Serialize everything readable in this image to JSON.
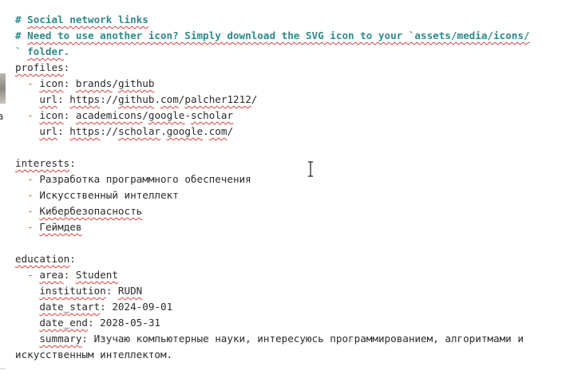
{
  "editor": {
    "lines": [
      {
        "type": "comment",
        "parts": [
          {
            "t": "# "
          },
          {
            "t": "Social network links",
            "sp": true
          }
        ]
      },
      {
        "type": "comment",
        "parts": [
          {
            "t": "# "
          },
          {
            "t": "Need to use another icon? Simply download the SVG icon to your `assets/media/icons/",
            "sp": true
          }
        ]
      },
      {
        "type": "comment",
        "parts": [
          {
            "t": "` "
          },
          {
            "t": "folder",
            "sp": true
          },
          {
            "t": "."
          }
        ]
      },
      {
        "type": "code",
        "parts": [
          {
            "t": "profiles",
            "sp": true
          },
          {
            "t": ":"
          }
        ]
      },
      {
        "type": "code",
        "parts": [
          {
            "t": "  "
          },
          {
            "t": "-",
            "dash": true
          },
          {
            "t": " "
          },
          {
            "t": "icon",
            "sp": true
          },
          {
            "t": ": "
          },
          {
            "t": "brands",
            "sp": true
          },
          {
            "t": "/"
          },
          {
            "t": "github",
            "sp": true
          }
        ]
      },
      {
        "type": "code",
        "parts": [
          {
            "t": "    "
          },
          {
            "t": "url",
            "sp": true
          },
          {
            "t": ": "
          },
          {
            "t": "https",
            "sp": true
          },
          {
            "t": "://"
          },
          {
            "t": "github",
            "sp": true
          },
          {
            "t": "."
          },
          {
            "t": "com",
            "sp": true
          },
          {
            "t": "/"
          },
          {
            "t": "palcher1212",
            "sp": true
          },
          {
            "t": "/"
          }
        ]
      },
      {
        "type": "code",
        "parts": [
          {
            "t": "  "
          },
          {
            "t": "-",
            "dash": true
          },
          {
            "t": " "
          },
          {
            "t": "icon",
            "sp": true
          },
          {
            "t": ": "
          },
          {
            "t": "academicons",
            "sp": true
          },
          {
            "t": "/"
          },
          {
            "t": "google",
            "sp": true
          },
          {
            "t": "-"
          },
          {
            "t": "scholar",
            "sp": true
          }
        ]
      },
      {
        "type": "code",
        "parts": [
          {
            "t": "    "
          },
          {
            "t": "url",
            "sp": true
          },
          {
            "t": ": "
          },
          {
            "t": "https",
            "sp": true
          },
          {
            "t": "://"
          },
          {
            "t": "scholar",
            "sp": true
          },
          {
            "t": "."
          },
          {
            "t": "google",
            "sp": true
          },
          {
            "t": "."
          },
          {
            "t": "com",
            "sp": true
          },
          {
            "t": "/"
          }
        ]
      },
      {
        "type": "blank",
        "parts": []
      },
      {
        "type": "code",
        "parts": [
          {
            "t": "interests",
            "sp": true
          },
          {
            "t": ":"
          }
        ]
      },
      {
        "type": "code",
        "parts": [
          {
            "t": "  "
          },
          {
            "t": "-",
            "dash": true
          },
          {
            "t": " Разработка программного обеспечения"
          }
        ]
      },
      {
        "type": "code",
        "parts": [
          {
            "t": "  "
          },
          {
            "t": "-",
            "dash": true
          },
          {
            "t": " Искусственный интеллект"
          }
        ]
      },
      {
        "type": "code",
        "parts": [
          {
            "t": "  "
          },
          {
            "t": "-",
            "dash": true
          },
          {
            "t": " "
          },
          {
            "t": "Кибербезопасность",
            "sp": true
          }
        ]
      },
      {
        "type": "code",
        "parts": [
          {
            "t": "  "
          },
          {
            "t": "-",
            "dash": true
          },
          {
            "t": " "
          },
          {
            "t": "Геймдев",
            "sp": true
          }
        ]
      },
      {
        "type": "blank",
        "parts": []
      },
      {
        "type": "code",
        "parts": [
          {
            "t": "education",
            "sp": true
          },
          {
            "t": ":"
          }
        ]
      },
      {
        "type": "code",
        "parts": [
          {
            "t": "  "
          },
          {
            "t": "-",
            "dash": true
          },
          {
            "t": " "
          },
          {
            "t": "area",
            "sp": true
          },
          {
            "t": ": "
          },
          {
            "t": "Student",
            "sp": true
          }
        ]
      },
      {
        "type": "code",
        "parts": [
          {
            "t": "    "
          },
          {
            "t": "institution",
            "sp": true
          },
          {
            "t": ": "
          },
          {
            "t": "RUDN",
            "sp": true
          }
        ]
      },
      {
        "type": "code",
        "parts": [
          {
            "t": "    "
          },
          {
            "t": "date_start",
            "sp": true
          },
          {
            "t": ": 2024-09-01"
          }
        ]
      },
      {
        "type": "code",
        "parts": [
          {
            "t": "    "
          },
          {
            "t": "date_end",
            "sp": true
          },
          {
            "t": ": 2028-05-31"
          }
        ]
      },
      {
        "type": "code",
        "parts": [
          {
            "t": "    "
          },
          {
            "t": "summary",
            "sp": true
          },
          {
            "t": ": Изучаю компьютерные науки, интересуюсь программированием, алгоритмами и"
          }
        ]
      },
      {
        "type": "code",
        "parts": [
          {
            "t": "искусственным интеллектом."
          }
        ]
      }
    ]
  },
  "left_panel": {
    "glyph": "a"
  },
  "colors": {
    "comment": "#2e8a8a",
    "dash": "#e0582a",
    "text": "#2b2b2b",
    "spellcheck": "#e03b3b"
  },
  "icons": {
    "cursor": "i-beam-cursor-icon"
  }
}
